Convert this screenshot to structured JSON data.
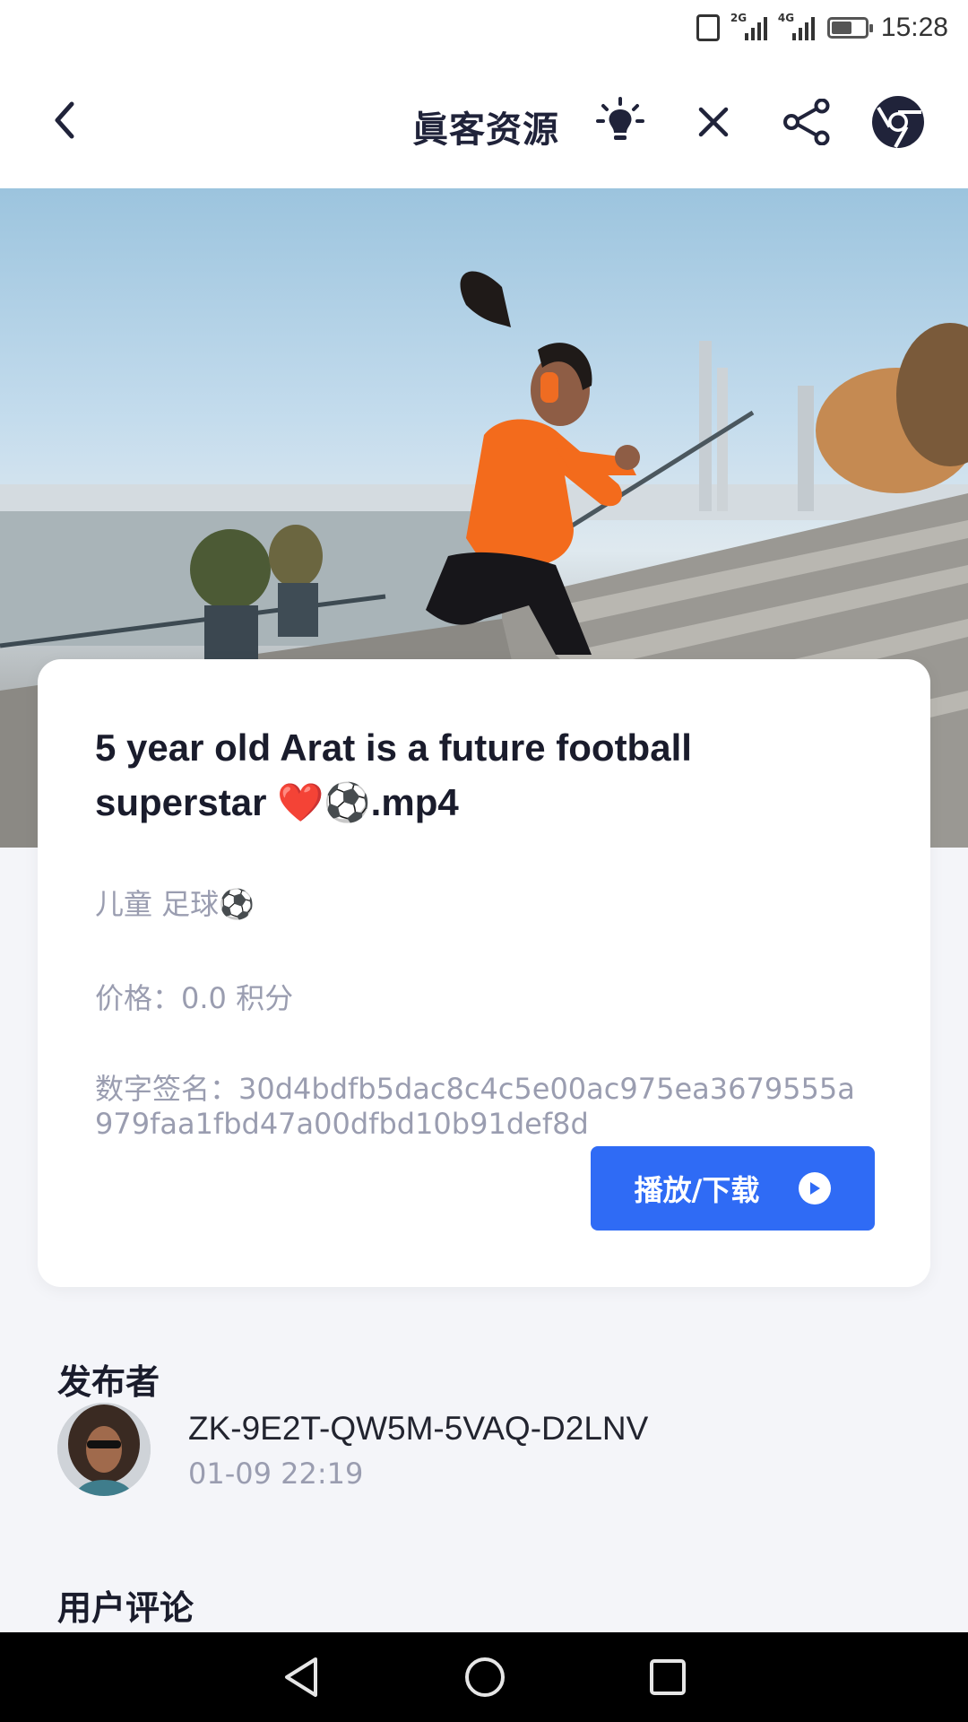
{
  "status_bar": {
    "time": "15:28",
    "network_1": "2G",
    "network_2": "4G",
    "battery_level": 0.6
  },
  "header": {
    "title": "眞客资源",
    "icons": [
      "back-icon",
      "lightbulb-icon",
      "close-icon",
      "share-icon",
      "browser-icon"
    ]
  },
  "hero": {
    "image": "woman in orange top jumping on stadium steps by river"
  },
  "card": {
    "title": "5 year old Arat is a future football superstar ❤️⚽.mp4",
    "tags": "儿童 足球⚽",
    "price": "价格：0.0 积分",
    "signature_label": "数字签名：",
    "signature": "30d4bdfb5dac8c4c5e00ac975ea3679555a979faa1fbd47a00dfbd10b91def8d",
    "play_button": "播放/下载"
  },
  "publisher": {
    "section_title": "发布者",
    "id": "ZK-9E2T-QW5M-5VAQ-D2LNV",
    "time": "01-09 22:19"
  },
  "comments": {
    "section_title": "用户评论"
  },
  "colors": {
    "accent": "#2f6bf5",
    "background": "#f4f5f9",
    "muted_text": "#9a9db0"
  }
}
